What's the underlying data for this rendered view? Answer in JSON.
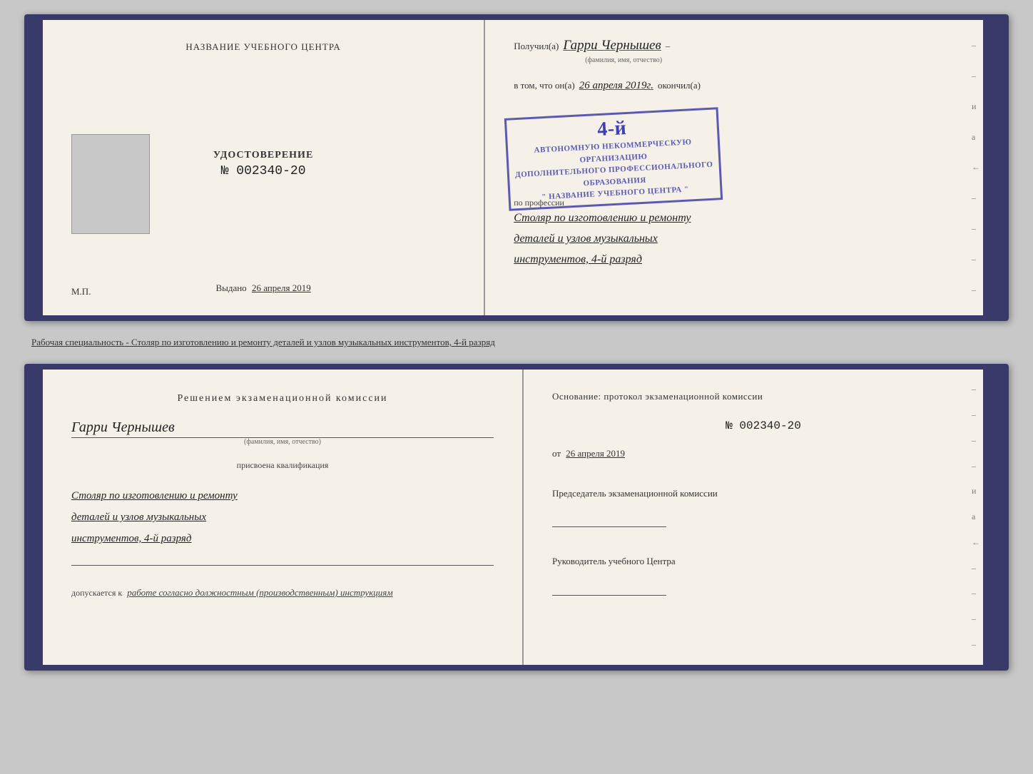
{
  "top_book": {
    "left_page": {
      "header": "НАЗВАНИЕ УЧЕБНОГО ЦЕНТРА",
      "photo_alt": "photo placeholder",
      "udost_title": "УДОСТОВЕРЕНИЕ",
      "udost_number": "№ 002340-20",
      "vydano_label": "Выдано",
      "vydano_date": "26 апреля 2019",
      "mp": "М.П."
    },
    "right_page": {
      "poluchil_label": "Получил(а)",
      "poluchil_name": "Гарри Чернышев",
      "name_sub": "(фамилия, имя, отчество)",
      "v_tom_label": "в том, что он(а)",
      "v_tom_date": "26 апреля 2019г.",
      "okonchil_label": "окончил(а)",
      "stamp_line1": "АВТОНОМНУЮ НЕКОММЕРЧЕСКУЮ ОРГАНИЗАЦИЮ",
      "stamp_line2": "ДОПОЛНИТЕЛЬНОГО ПРОФЕССИОНАЛЬНОГО ОБРАЗОВАНИЯ",
      "stamp_line3": "\" НАЗВАНИЕ УЧЕБНОГО ЦЕНТРА \"",
      "stamp_big": "4-й",
      "po_professii": "по профессии",
      "profession_line1": "Столяр по изготовлению и ремонту",
      "profession_line2": "деталей и узлов музыкальных",
      "profession_line3": "инструментов, 4-й разряд"
    }
  },
  "separator": {
    "text": "Рабочая специальность - Столяр по изготовлению и ремонту деталей и узлов музыкальных инструментов, 4-й разряд"
  },
  "bottom_book": {
    "left_page": {
      "resheniem_title": "Решением  экзаменационной  комиссии",
      "name": "Гарри Чернышев",
      "name_sub": "(фамилия, имя, отчество)",
      "prisvоена": "присвоена квалификация",
      "profession_line1": "Столяр по изготовлению и ремонту",
      "profession_line2": "деталей и узлов музыкальных",
      "profession_line3": "инструментов, 4-й разряд",
      "dopuskaetsya_label": "допускается к",
      "dopuskaetsya_value": "работе согласно должностным (производственным) инструкциям"
    },
    "right_page": {
      "osnov_title": "Основание: протокол экзаменационной  комиссии",
      "number": "№  002340-20",
      "ot_label": "от",
      "ot_date": "26 апреля 2019",
      "chairman_title": "Председатель экзаменационной комиссии",
      "ruk_title": "Руководитель учебного Центра"
    }
  }
}
